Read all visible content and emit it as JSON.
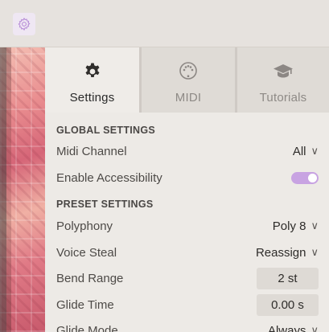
{
  "topbar": {
    "settings_icon": "gear-icon"
  },
  "tabs": [
    {
      "label": "Settings",
      "icon": "gear-icon",
      "active": true
    },
    {
      "label": "MIDI",
      "icon": "midi-connector-icon",
      "active": false
    },
    {
      "label": "Tutorials",
      "icon": "graduation-cap-icon",
      "active": false
    }
  ],
  "global": {
    "heading": "GLOBAL SETTINGS",
    "midi_channel": {
      "label": "Midi Channel",
      "value": "All"
    },
    "accessibility": {
      "label": "Enable Accessibility",
      "enabled": true
    }
  },
  "preset": {
    "heading": "PRESET SETTINGS",
    "polyphony": {
      "label": "Polyphony",
      "value": "Poly 8"
    },
    "voice_steal": {
      "label": "Voice Steal",
      "value": "Reassign"
    },
    "bend_range": {
      "label": "Bend Range",
      "value": "2 st"
    },
    "glide_time": {
      "label": "Glide Time",
      "value": "0.00 s"
    },
    "glide_mode": {
      "label": "Glide Mode",
      "value": "Always"
    }
  },
  "colors": {
    "accent": "#c8a3e2",
    "icon_accent": "#b58ad6"
  },
  "glyphs": {
    "chevron": "∨"
  }
}
